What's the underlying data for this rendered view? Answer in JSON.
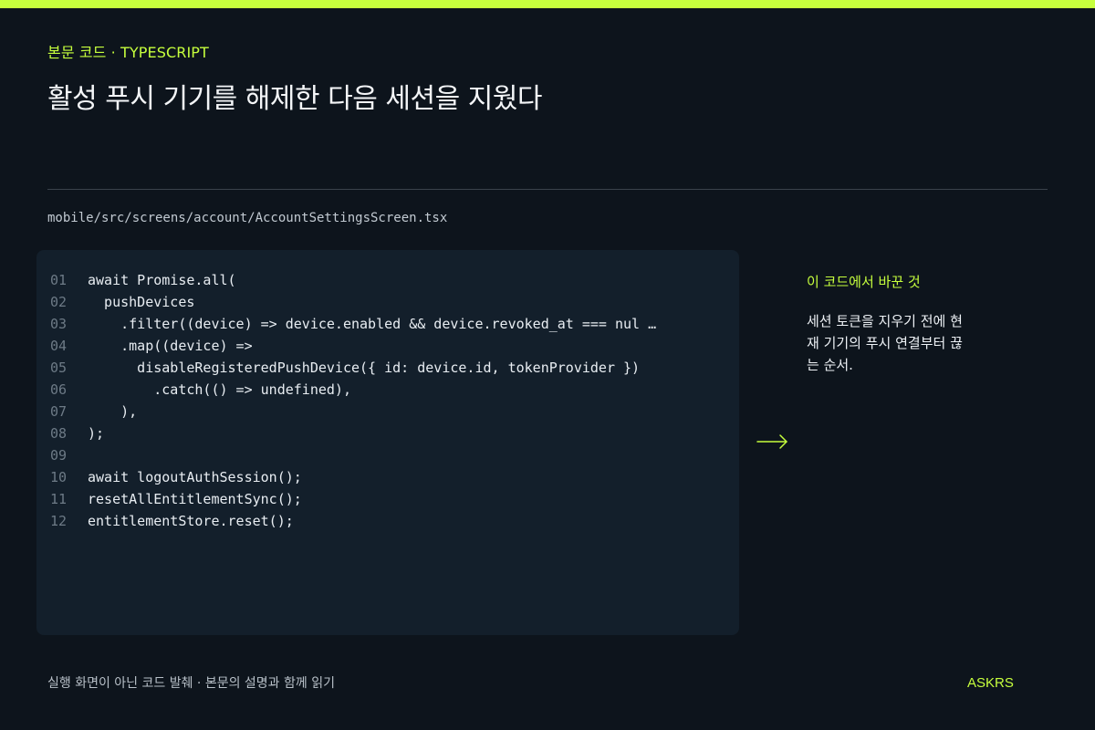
{
  "header": {
    "eyebrow": "본문 코드 · TYPESCRIPT",
    "title": "활성 푸시 기기를 해제한 다음 세션을 지웠다"
  },
  "file": {
    "path": "mobile/src/screens/account/AccountSettingsScreen.tsx"
  },
  "code": {
    "lines": [
      {
        "no": "01",
        "text": "await Promise.all("
      },
      {
        "no": "02",
        "text": "  pushDevices"
      },
      {
        "no": "03",
        "text": "    .filter((device) => device.enabled && device.revoked_at === nul …"
      },
      {
        "no": "04",
        "text": "    .map((device) =>"
      },
      {
        "no": "05",
        "text": "      disableRegisteredPushDevice({ id: device.id, tokenProvider })"
      },
      {
        "no": "06",
        "text": "        .catch(() => undefined),"
      },
      {
        "no": "07",
        "text": "    ),"
      },
      {
        "no": "08",
        "text": ");"
      },
      {
        "no": "09",
        "text": ""
      },
      {
        "no": "10",
        "text": "await logoutAuthSession();"
      },
      {
        "no": "11",
        "text": "resetAllEntitlementSync();"
      },
      {
        "no": "12",
        "text": "entitlementStore.reset();"
      }
    ]
  },
  "annotation": {
    "icon": "arrow-right-icon",
    "title": "이 코드에서 바꾼 것",
    "body_lines": [
      "세션 토큰을 지우기 전에 현",
      "재 기기의 푸시 연결부터 끊",
      "는 순서."
    ]
  },
  "footer": {
    "note": "실행 화면이 아닌 코드 발췌 · 본문의 설명과 함께 읽기",
    "brand": "ASKRS"
  },
  "colors": {
    "accent": "#c6ff3d",
    "background": "#0d141c",
    "code_panel": "#131f2b"
  }
}
